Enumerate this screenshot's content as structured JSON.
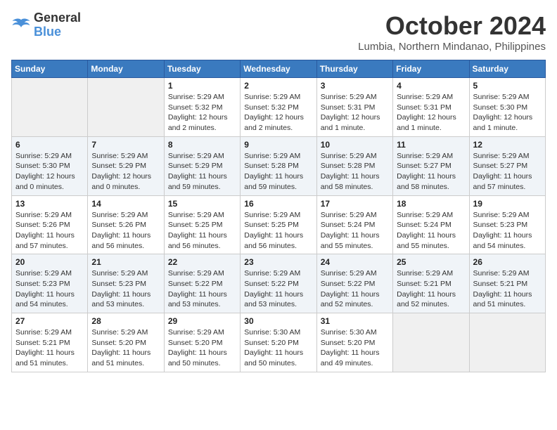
{
  "logo": {
    "line1": "General",
    "line2": "Blue"
  },
  "title": "October 2024",
  "subtitle": "Lumbia, Northern Mindanao, Philippines",
  "weekdays": [
    "Sunday",
    "Monday",
    "Tuesday",
    "Wednesday",
    "Thursday",
    "Friday",
    "Saturday"
  ],
  "weeks": [
    [
      {
        "day": "",
        "info": ""
      },
      {
        "day": "",
        "info": ""
      },
      {
        "day": "1",
        "info": "Sunrise: 5:29 AM\nSunset: 5:32 PM\nDaylight: 12 hours and 2 minutes."
      },
      {
        "day": "2",
        "info": "Sunrise: 5:29 AM\nSunset: 5:32 PM\nDaylight: 12 hours and 2 minutes."
      },
      {
        "day": "3",
        "info": "Sunrise: 5:29 AM\nSunset: 5:31 PM\nDaylight: 12 hours and 1 minute."
      },
      {
        "day": "4",
        "info": "Sunrise: 5:29 AM\nSunset: 5:31 PM\nDaylight: 12 hours and 1 minute."
      },
      {
        "day": "5",
        "info": "Sunrise: 5:29 AM\nSunset: 5:30 PM\nDaylight: 12 hours and 1 minute."
      }
    ],
    [
      {
        "day": "6",
        "info": "Sunrise: 5:29 AM\nSunset: 5:30 PM\nDaylight: 12 hours and 0 minutes."
      },
      {
        "day": "7",
        "info": "Sunrise: 5:29 AM\nSunset: 5:29 PM\nDaylight: 12 hours and 0 minutes."
      },
      {
        "day": "8",
        "info": "Sunrise: 5:29 AM\nSunset: 5:29 PM\nDaylight: 11 hours and 59 minutes."
      },
      {
        "day": "9",
        "info": "Sunrise: 5:29 AM\nSunset: 5:28 PM\nDaylight: 11 hours and 59 minutes."
      },
      {
        "day": "10",
        "info": "Sunrise: 5:29 AM\nSunset: 5:28 PM\nDaylight: 11 hours and 58 minutes."
      },
      {
        "day": "11",
        "info": "Sunrise: 5:29 AM\nSunset: 5:27 PM\nDaylight: 11 hours and 58 minutes."
      },
      {
        "day": "12",
        "info": "Sunrise: 5:29 AM\nSunset: 5:27 PM\nDaylight: 11 hours and 57 minutes."
      }
    ],
    [
      {
        "day": "13",
        "info": "Sunrise: 5:29 AM\nSunset: 5:26 PM\nDaylight: 11 hours and 57 minutes."
      },
      {
        "day": "14",
        "info": "Sunrise: 5:29 AM\nSunset: 5:26 PM\nDaylight: 11 hours and 56 minutes."
      },
      {
        "day": "15",
        "info": "Sunrise: 5:29 AM\nSunset: 5:25 PM\nDaylight: 11 hours and 56 minutes."
      },
      {
        "day": "16",
        "info": "Sunrise: 5:29 AM\nSunset: 5:25 PM\nDaylight: 11 hours and 56 minutes."
      },
      {
        "day": "17",
        "info": "Sunrise: 5:29 AM\nSunset: 5:24 PM\nDaylight: 11 hours and 55 minutes."
      },
      {
        "day": "18",
        "info": "Sunrise: 5:29 AM\nSunset: 5:24 PM\nDaylight: 11 hours and 55 minutes."
      },
      {
        "day": "19",
        "info": "Sunrise: 5:29 AM\nSunset: 5:23 PM\nDaylight: 11 hours and 54 minutes."
      }
    ],
    [
      {
        "day": "20",
        "info": "Sunrise: 5:29 AM\nSunset: 5:23 PM\nDaylight: 11 hours and 54 minutes."
      },
      {
        "day": "21",
        "info": "Sunrise: 5:29 AM\nSunset: 5:23 PM\nDaylight: 11 hours and 53 minutes."
      },
      {
        "day": "22",
        "info": "Sunrise: 5:29 AM\nSunset: 5:22 PM\nDaylight: 11 hours and 53 minutes."
      },
      {
        "day": "23",
        "info": "Sunrise: 5:29 AM\nSunset: 5:22 PM\nDaylight: 11 hours and 53 minutes."
      },
      {
        "day": "24",
        "info": "Sunrise: 5:29 AM\nSunset: 5:22 PM\nDaylight: 11 hours and 52 minutes."
      },
      {
        "day": "25",
        "info": "Sunrise: 5:29 AM\nSunset: 5:21 PM\nDaylight: 11 hours and 52 minutes."
      },
      {
        "day": "26",
        "info": "Sunrise: 5:29 AM\nSunset: 5:21 PM\nDaylight: 11 hours and 51 minutes."
      }
    ],
    [
      {
        "day": "27",
        "info": "Sunrise: 5:29 AM\nSunset: 5:21 PM\nDaylight: 11 hours and 51 minutes."
      },
      {
        "day": "28",
        "info": "Sunrise: 5:29 AM\nSunset: 5:20 PM\nDaylight: 11 hours and 51 minutes."
      },
      {
        "day": "29",
        "info": "Sunrise: 5:29 AM\nSunset: 5:20 PM\nDaylight: 11 hours and 50 minutes."
      },
      {
        "day": "30",
        "info": "Sunrise: 5:30 AM\nSunset: 5:20 PM\nDaylight: 11 hours and 50 minutes."
      },
      {
        "day": "31",
        "info": "Sunrise: 5:30 AM\nSunset: 5:20 PM\nDaylight: 11 hours and 49 minutes."
      },
      {
        "day": "",
        "info": ""
      },
      {
        "day": "",
        "info": ""
      }
    ]
  ]
}
